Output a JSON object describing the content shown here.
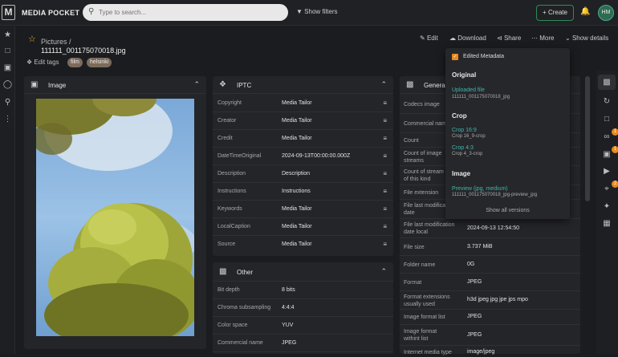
{
  "app": {
    "name": "MEDIA POCKET",
    "logo_letter": "M"
  },
  "search": {
    "placeholder": "Type to search..."
  },
  "topbar": {
    "filters_label": "Show filters",
    "create_label": "Create",
    "avatar_initials": "HM"
  },
  "rightbar": {
    "badges": [
      "1",
      "1",
      "2"
    ]
  },
  "header": {
    "breadcrumb": "Pictures  /",
    "filename": "111111_001175070018.jpg",
    "edit_tags_label": "Edit tags",
    "tags": [
      "film",
      "helsinki"
    ],
    "actions": {
      "edit": "Edit",
      "download": "Download",
      "share": "Share",
      "more": "More",
      "show_details": "Show details"
    }
  },
  "image_panel": {
    "title": "Image"
  },
  "iptc_panel": {
    "title": "IPTC",
    "rows": [
      {
        "label": "Copyright",
        "value": "Media Tailor"
      },
      {
        "label": "Creator",
        "value": "Media Tailor"
      },
      {
        "label": "Credit",
        "value": "Media Tailor"
      },
      {
        "label": "DateTimeOriginal",
        "value": "2024-09-13T00:00:00.000Z"
      },
      {
        "label": "Description",
        "value": "Description"
      },
      {
        "label": "Instructions",
        "value": "Instructions"
      },
      {
        "label": "Keywords",
        "value": "Media Tailor"
      },
      {
        "label": "LocalCaption",
        "value": "Media Tailor"
      },
      {
        "label": "Source",
        "value": "Media Tailor"
      }
    ]
  },
  "other_panel": {
    "title": "Other",
    "rows": [
      {
        "label": "Bit depth",
        "value": "8 bits"
      },
      {
        "label": "Chroma subsampling",
        "value": "4:4:4"
      },
      {
        "label": "Color space",
        "value": "YUV"
      },
      {
        "label": "Commercial name",
        "value": "JPEG"
      }
    ]
  },
  "general_panel": {
    "title": "General",
    "rows": [
      {
        "label": "Codecs image",
        "value": ""
      },
      {
        "label": "Commercial name",
        "value": ""
      },
      {
        "label": "Count",
        "value": ""
      },
      {
        "label": "Count of image streams",
        "value": ""
      },
      {
        "label": "Count of stream of this kind",
        "value": ""
      },
      {
        "label": "File extension",
        "value": ""
      },
      {
        "label": "File last modification date",
        "value": ""
      },
      {
        "label": "File last modification date local",
        "value": "2024-09-13 12:54:50"
      },
      {
        "label": "File size",
        "value": "3.737 MiB"
      },
      {
        "label": "Folder name",
        "value": "0G"
      },
      {
        "label": "Format",
        "value": "JPEG"
      },
      {
        "label": "Format extensions usually used",
        "value": "h3d jpeg jpg jpe jps mpo"
      },
      {
        "label": "Image format list",
        "value": "JPEG"
      },
      {
        "label": "Image format withint list",
        "value": "JPEG"
      },
      {
        "label": "Internet media type",
        "value": "image/jpeg"
      }
    ]
  },
  "dropdown": {
    "edited_metadata": "Edited Metadata",
    "sections": [
      {
        "heading": "Original",
        "items": [
          {
            "name": "Uploaded file",
            "sub": "111111_001175070018_jpg"
          }
        ]
      },
      {
        "heading": "Crop",
        "items": [
          {
            "name": "Crop 16:9",
            "sub": "Crop 16_9-crop"
          },
          {
            "name": "Crop 4:3",
            "sub": "Crop 4_3-crop"
          }
        ]
      },
      {
        "heading": "Image",
        "items": [
          {
            "name": "Preview (jpg, medium)",
            "sub": "111111_001175070018_jpg-preview_jpg"
          }
        ]
      }
    ],
    "show_all": "Show all versions"
  },
  "colors": {
    "accent": "#3fb6a8",
    "star": "#e3b03a",
    "badge": "#e8891f",
    "create_border": "#2e8b57"
  }
}
